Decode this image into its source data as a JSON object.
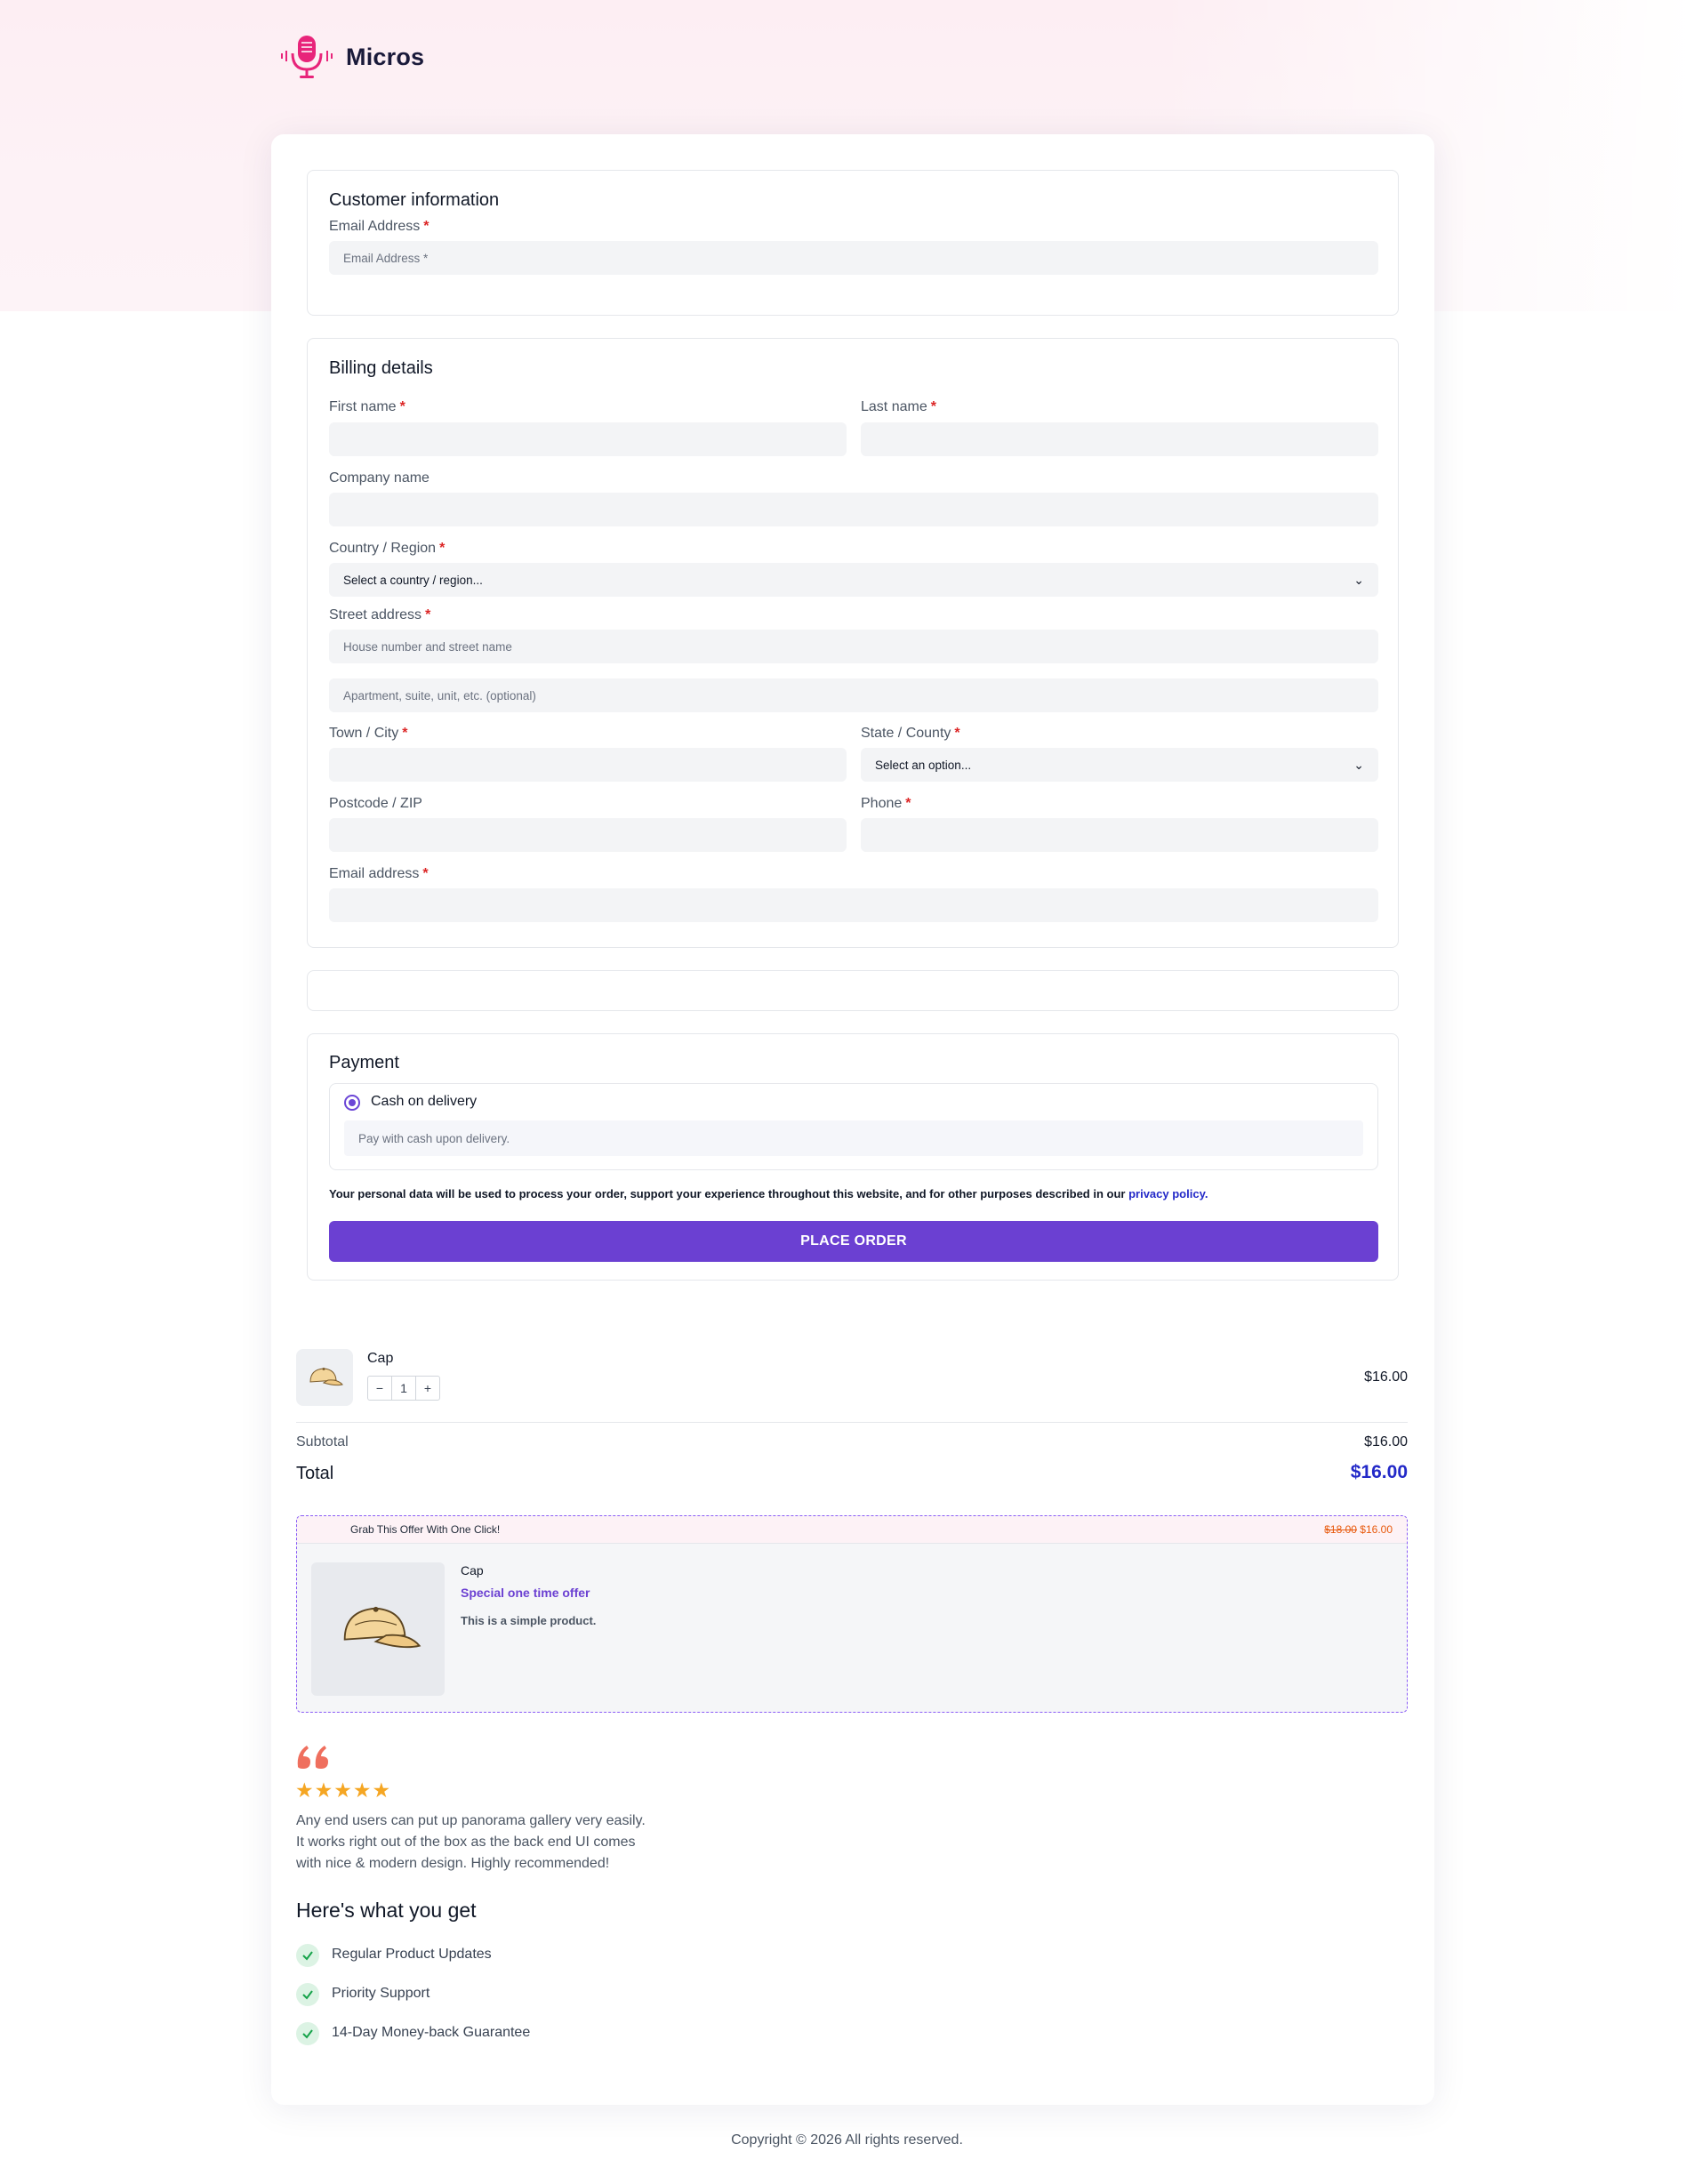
{
  "brand": {
    "name": "Micros"
  },
  "customer_info": {
    "title": "Customer information",
    "email_label": "Email Address",
    "email_placeholder": "Email Address *"
  },
  "billing": {
    "title": "Billing details",
    "first_name_label": "First name",
    "last_name_label": "Last name",
    "company_label": "Company name",
    "country_label": "Country / Region",
    "country_value": "Select a country / region...",
    "street_label": "Street address",
    "street_placeholder": "House number and street name",
    "street2_placeholder": "Apartment, suite, unit, etc. (optional)",
    "city_label": "Town / City",
    "state_label": "State / County",
    "state_value": "Select an option...",
    "postcode_label": "Postcode / ZIP",
    "phone_label": "Phone",
    "email_label": "Email address"
  },
  "payment": {
    "title": "Payment",
    "method_label": "Cash on delivery",
    "method_desc": "Pay with cash upon delivery.",
    "privacy_text": "Your personal data will be used to process your order, support your experience throughout this website, and for other purposes described in our",
    "privacy_link": "privacy policy.",
    "place_order": "PLACE ORDER"
  },
  "order": {
    "item_name": "Cap",
    "qty": "1",
    "qty_minus": "−",
    "qty_plus": "+",
    "item_price": "$16.00",
    "subtotal_label": "Subtotal",
    "subtotal_value": "$16.00",
    "total_label": "Total",
    "total_value": "$16.00"
  },
  "offer": {
    "headline": "Grab This Offer With One Click!",
    "old_price": "$18.00",
    "new_price": "$16.00",
    "product": "Cap",
    "tagline": "Special one time offer",
    "desc": "This is a simple product."
  },
  "testimonial": {
    "stars": "★★★★★",
    "line1": "Any end users can put up panorama gallery very easily.",
    "line2": "It works right out of the box as the back end UI comes",
    "line3": "with nice & modern design. Highly recommended!"
  },
  "benefits": {
    "title": "Here's what you get",
    "items": [
      "Regular Product Updates",
      "Priority Support",
      "14-Day Money-back Guarantee"
    ]
  },
  "footer": {
    "copyright": "Copyright © 2026 All rights reserved."
  },
  "colors": {
    "accent": "#6b40d2",
    "required": "#dc2626",
    "total": "#2329c8",
    "star": "#f5a623",
    "quote": "#ef6f5e"
  },
  "icons": [
    "microphone-logo-icon",
    "chevron-down-icon",
    "radio-selected-icon",
    "cap-icon",
    "quote-icon",
    "check-icon"
  ]
}
